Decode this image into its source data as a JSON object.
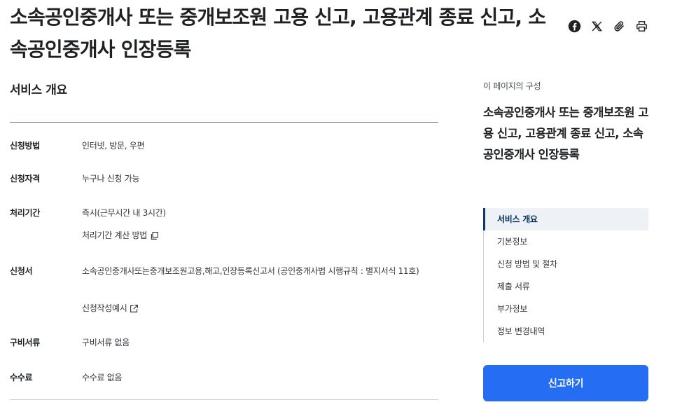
{
  "title": "소속공인중개사 또는 중개보조원 고용 신고, 고용관계 종료 신고, 소속공인중개사 인장등록",
  "share": {
    "facebook_icon": "facebook-icon",
    "x_icon": "x-icon",
    "link_icon": "paperclip-icon",
    "print_icon": "printer-icon"
  },
  "section": {
    "title": "서비스 개요"
  },
  "info": [
    {
      "label": "신청방법",
      "value": "인터넷, 방문, 우편"
    },
    {
      "label": "신청자격",
      "value": "누구나 신청 가능"
    },
    {
      "label": "처리기간",
      "value": "즉시(근무시간 내 3시간)",
      "link": "처리기간 계산 방법"
    },
    {
      "label": "신청서",
      "value": "소속공인중개사또는중개보조원고용,해고,인장등록신고서 (공인중개사법 시행규칙 : 별지서식 11호)",
      "link": "신청작성예시"
    },
    {
      "label": "구비서류",
      "value": "구비서류 없음"
    },
    {
      "label": "수수료",
      "value": "수수료 없음"
    }
  ],
  "toc": {
    "caption": "이 페이지의 구성",
    "heading": "소속공인중개사 또는 중개보조원 고용 신고, 고용관계 종료 신고, 소속공인중개사 인장등록",
    "items": [
      {
        "label": "서비스 개요",
        "active": true
      },
      {
        "label": "기본정보",
        "active": false
      },
      {
        "label": "신청 방법 및 절차",
        "active": false
      },
      {
        "label": "제출 서류",
        "active": false
      },
      {
        "label": "부가정보",
        "active": false
      },
      {
        "label": "정보 변경내역",
        "active": false
      }
    ]
  },
  "report_button": "신고하기",
  "colors": {
    "primary": "#256ef4",
    "active_bar": "#0b3b74",
    "active_bg": "#eef2f7"
  }
}
